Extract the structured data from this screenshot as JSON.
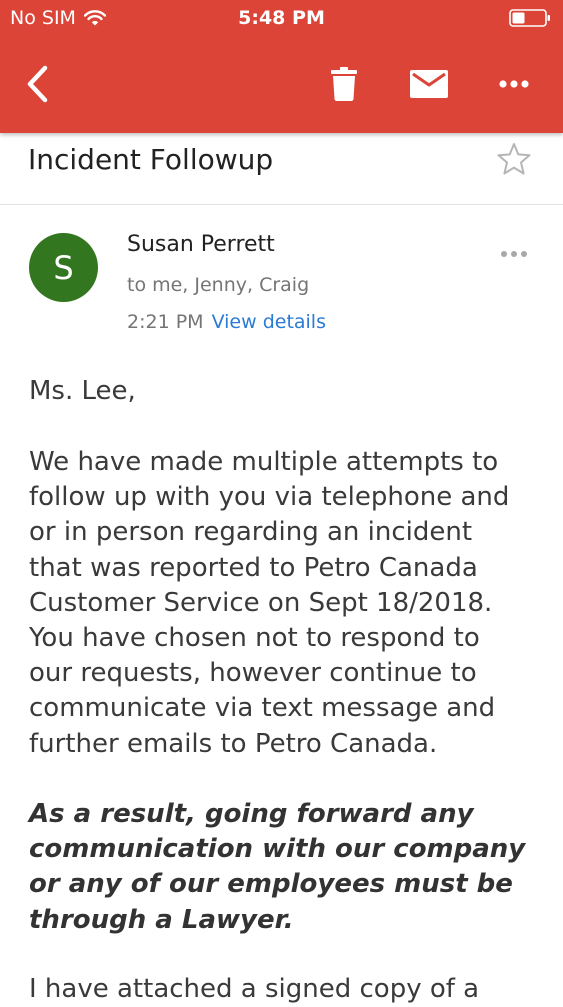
{
  "status_bar": {
    "carrier": "No SIM",
    "time": "5:48 PM",
    "wifi_icon": "wifi-icon",
    "battery_icon": "battery-icon"
  },
  "toolbar": {
    "back_icon": "back-chevron-icon",
    "delete_icon": "trash-icon",
    "mark_icon": "mail-icon",
    "more_icon": "more-horizontal-icon"
  },
  "email": {
    "subject": "Incident Followup",
    "star_icon": "star-icon",
    "sender": {
      "initial": "S",
      "name": "Susan Perrett",
      "recipients": "to me, Jenny, Craig",
      "time": "2:21 PM",
      "view_details": "View details"
    },
    "body": {
      "greeting": "Ms. Lee,",
      "paragraph1": "We have made multiple attempts to\nfollow up with you via telephone and\nor in person regarding  an incident\nthat was reported to Petro Canada\nCustomer Service on Sept 18/2018.\nYou have chosen not to respond to\nour requests, however continue to\ncommunicate via text message and\nfurther emails to Petro Canada.",
      "paragraph2": "As a result, going forward any\ncommunication with our company\nor any of our employees must be\nthrough a Lawyer.",
      "paragraph3": "I have attached  a signed copy of a"
    }
  },
  "colors": {
    "toolbar_bg": "#dc4437",
    "avatar_bg": "#32761f",
    "link": "#2a7bd6"
  }
}
